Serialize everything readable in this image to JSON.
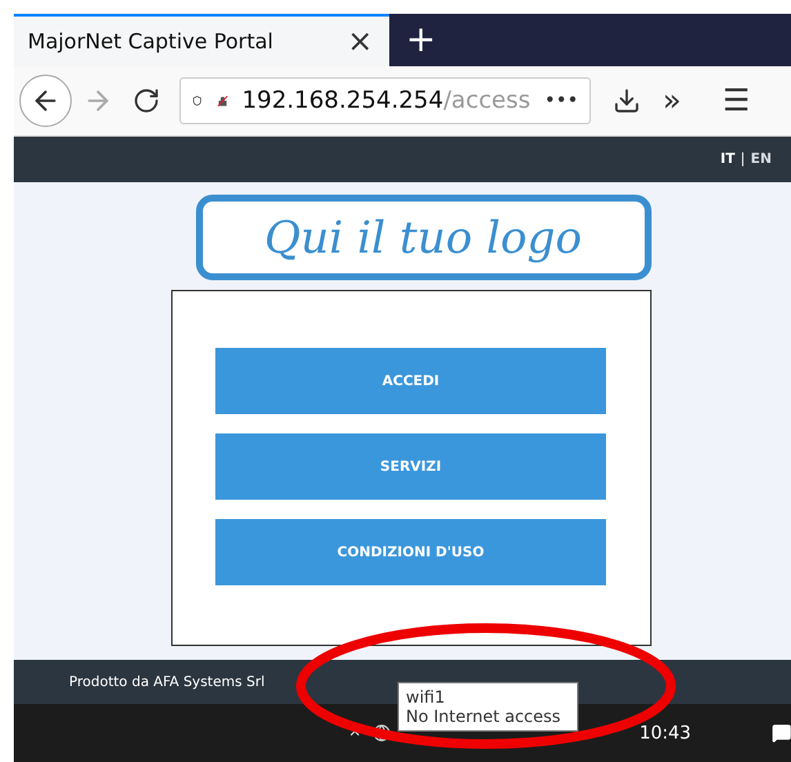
{
  "tab": {
    "title": "MajorNet Captive Portal",
    "close": "×",
    "new_tab": "+"
  },
  "address_bar": {
    "host": "192.168.254.254",
    "path": "/access",
    "more": "•••"
  },
  "toolbar": {
    "overflow": "»",
    "menu": "☰"
  },
  "header": {
    "languages": [
      {
        "label": "IT",
        "selected": true
      },
      {
        "label": "EN",
        "selected": false
      }
    ],
    "separator": "|"
  },
  "logo": {
    "text": "Qui il tuo logo"
  },
  "buttons": [
    "ACCEDI",
    "SERVIZI",
    "CONDIZIONI D'USO"
  ],
  "footer": {
    "text": "Prodotto da AFA Systems Srl"
  },
  "taskbar": {
    "time": "10:43"
  },
  "tooltip": {
    "network": "wifi1",
    "status": "No Internet access"
  }
}
